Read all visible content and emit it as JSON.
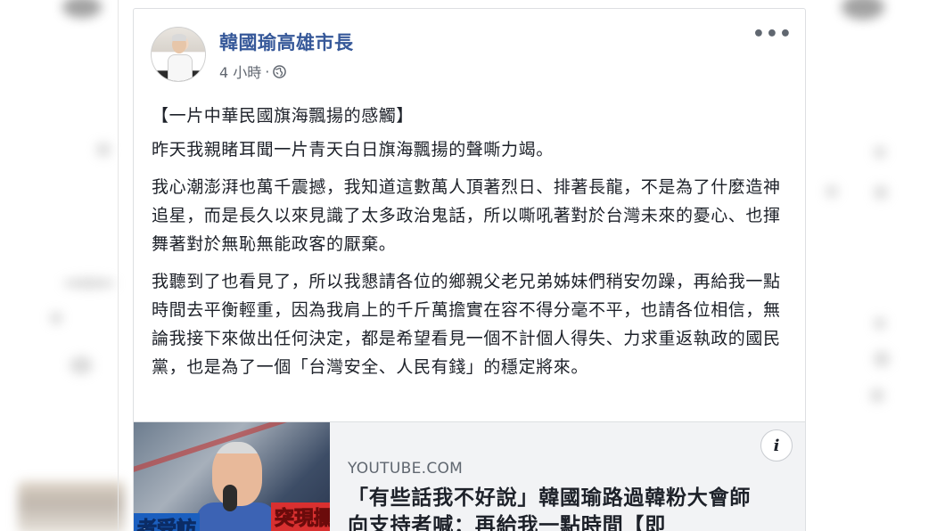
{
  "post": {
    "page_name": "韓國瑜高雄市長",
    "timestamp": "4 小時",
    "separator": "·",
    "more_label": "•••",
    "paragraphs": [
      "【一片中華民國旗海飄揚的感觸】",
      "昨天我親睹耳聞一片青天白日旗海飄揚的聲嘶力竭。",
      "我心潮澎湃也萬千震撼，我知道這數萬人頂著烈日、排著長龍，不是為了什麼造神追星，而是長久以來見識了太多政治鬼話，所以嘶吼著對於台灣未來的憂心、也揮舞著對於無恥無能政客的厭棄。",
      "我聽到了也看見了，所以我懇請各位的鄉親父老兄弟姊妹們稍安勿躁，再給我一點時間去平衡輕重，因為我肩上的千斤萬擔實在容不得分毫不平，也請各位相信，無論我接下來做出任何決定，都是希望看見一個不計個人得失、力求重返執政的國民黨，也是為了一個「台灣安全、人民有錢」的穩定將來。"
    ]
  },
  "link_card": {
    "info_label": "i",
    "domain": "YOUTUBE.COM",
    "headline": "「有些話我不好說」韓國瑜路過韓粉大會師 向支持者喊：再給我一點時間【即",
    "thumb_caption_left": "者受訪",
    "thumb_caption_right": "突現攔"
  },
  "icons": {
    "privacy": "globe-icon",
    "options": "more-options-icon",
    "info": "info-icon"
  },
  "colors": {
    "name_link": "#365899",
    "meta_text": "#616770",
    "body_text": "#1d2129",
    "card_bg": "#f2f3f5"
  }
}
